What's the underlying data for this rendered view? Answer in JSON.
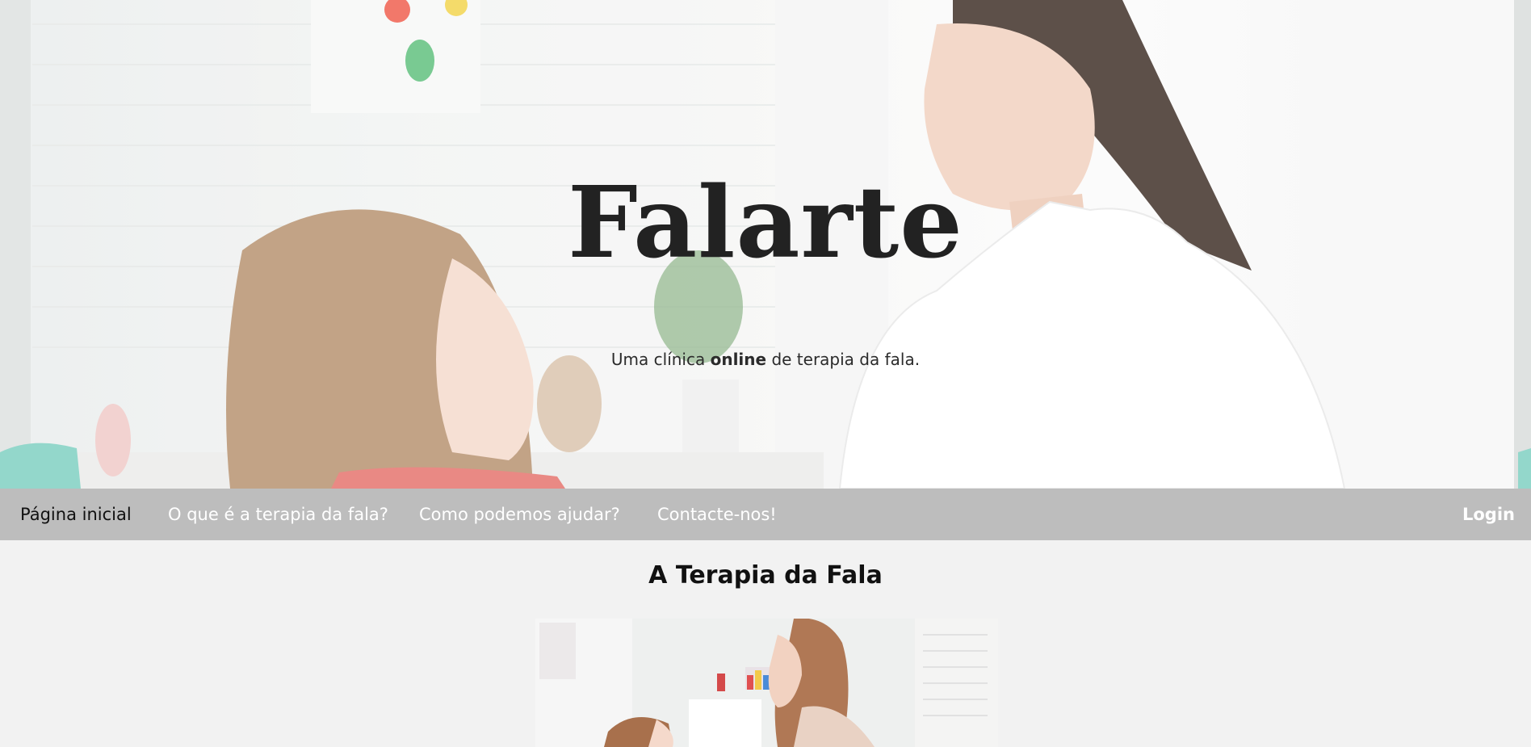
{
  "hero": {
    "title": "Falarte",
    "tagline_before": "Uma clínica ",
    "tagline_bold": "online",
    "tagline_after": " de terapia da fala."
  },
  "nav": {
    "items": [
      {
        "label": "Página inicial",
        "active": true
      },
      {
        "label": "O que é a terapia da fala?",
        "active": false
      },
      {
        "label": "Como podemos ajudar?",
        "active": false
      },
      {
        "label": "Contacte-nos!",
        "active": false
      }
    ],
    "login_label": "Login"
  },
  "section": {
    "title": "A Terapia da Fala"
  },
  "colors": {
    "navbar_bg": "#bdbdbd",
    "page_bg": "#f2f2f2",
    "nav_text": "#ffffff",
    "nav_active_text": "#111111"
  }
}
